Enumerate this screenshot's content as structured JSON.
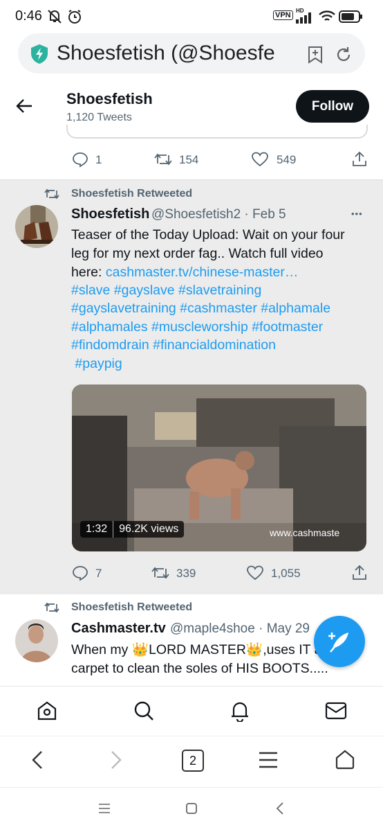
{
  "status_bar": {
    "time": "0:46",
    "vpn": "VPN",
    "hd": "HD"
  },
  "browser": {
    "url_title": "Shoesfetish (@Shoesfe",
    "tab_count": "2"
  },
  "profile": {
    "name": "Shoesfetish",
    "tweet_count": "1,120 Tweets",
    "follow_label": "Follow"
  },
  "prev_tweet": {
    "replies": "1",
    "retweets": "154",
    "likes": "549"
  },
  "tweet1": {
    "retweeted_by": "Shoesfetish Retweeted",
    "author": "Shoesfetish",
    "handle_date": "@Shoesfetish2 · Feb 5",
    "more": "•••",
    "line1": "Teaser of the Today Upload: Wait on your four",
    "line2": "leg for my next order fag..   Watch full video",
    "line3_prefix": "here: ",
    "line3_link": "cashmaster.tv/chinese-master…",
    "hashtags1": "#slave #gayslave #slavetraining",
    "hashtags2": "#gayslavetraining #cashmaster #alphamale",
    "hashtags3": "#alphamales #muscleworship #footmaster",
    "hashtags4": "#findomdrain #financialdomination",
    "hashtags5": " #paypig",
    "video_duration": "1:32",
    "video_views": "96.2K views",
    "video_watermark": "www.cashmaste",
    "replies": "7",
    "retweets": "339",
    "likes": "1,055"
  },
  "tweet2": {
    "retweeted_by": "Shoesfetish Retweeted",
    "author": "Cashmaster.tv",
    "handle_date": "@maple4shoe · May 29",
    "line1_a": "When my ",
    "line1_b": "LORD MASTER",
    "line1_c": ",uses IT a",
    "line2": "carpet to clean the soles of HIS BOOTS.....",
    "crown": "👑"
  },
  "colors": {
    "accent": "#1d9bf0",
    "text": "#0f1419",
    "muted": "#536471",
    "shield": "#2bb3a0"
  }
}
